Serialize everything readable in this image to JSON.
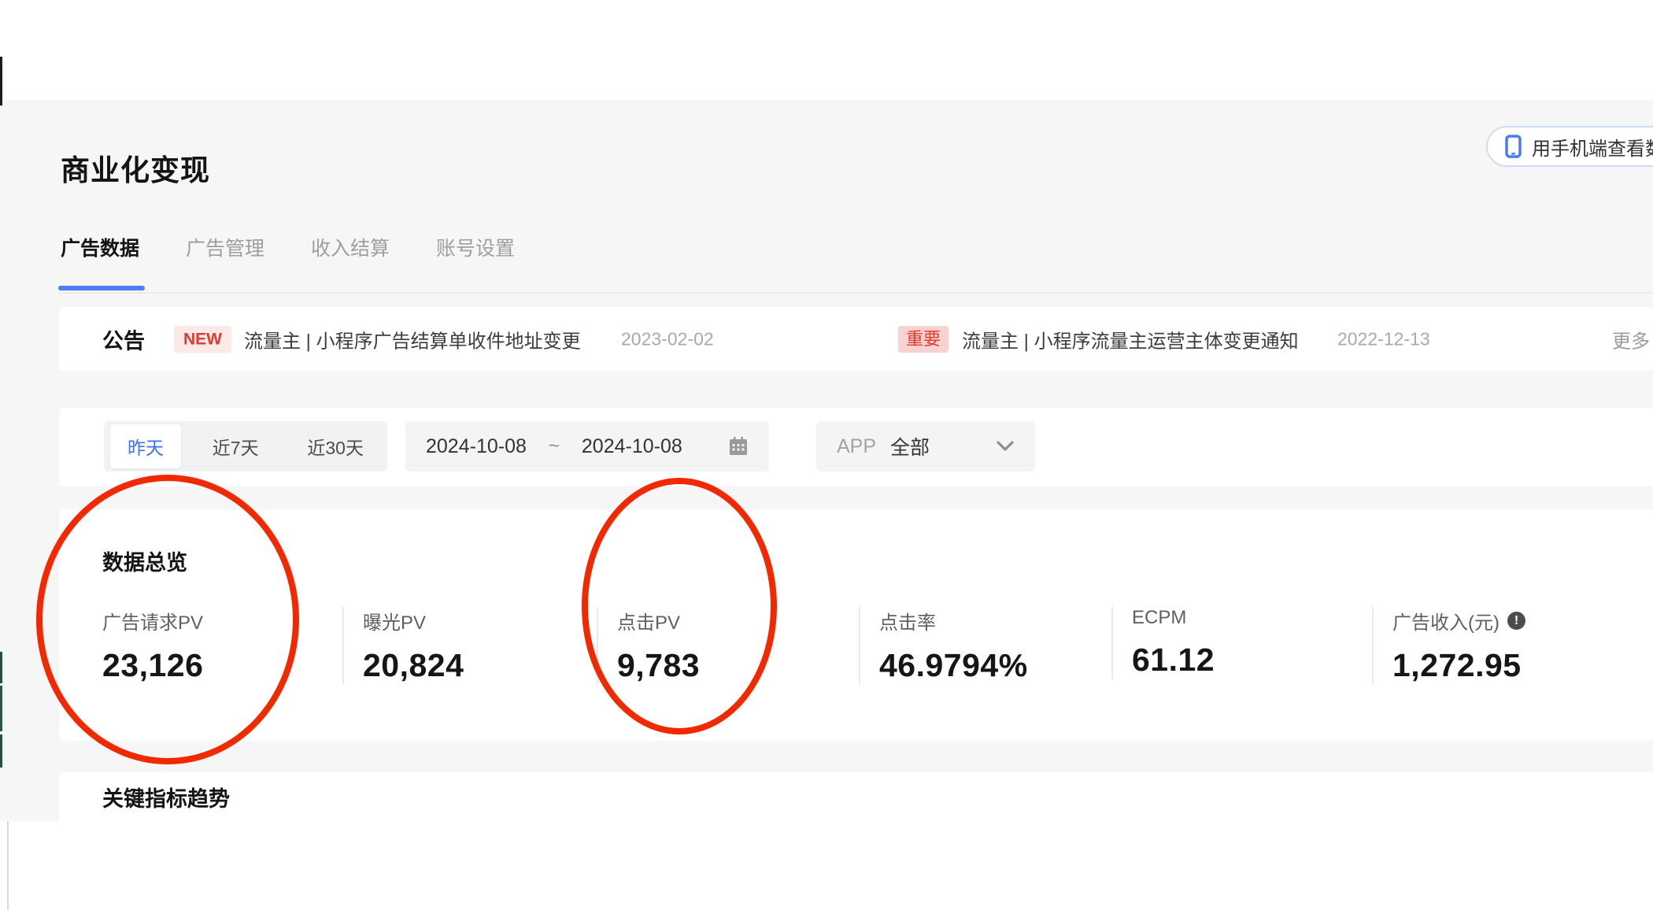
{
  "page": {
    "title": "商业化变现",
    "mobile_view_button": {
      "label": "用手机端查看数据"
    }
  },
  "tabs": {
    "items": [
      {
        "label": "广告数据",
        "active": true
      },
      {
        "label": "广告管理",
        "active": false
      },
      {
        "label": "收入结算",
        "active": false
      },
      {
        "label": "账号设置",
        "active": false
      }
    ]
  },
  "announcement": {
    "title": "公告",
    "items": [
      {
        "badge": "NEW",
        "text": "流量主 | 小程序广告结算单收件地址变更",
        "date": "2023-02-02"
      },
      {
        "badge": "重要",
        "text": "流量主 | 小程序流量主运营主体变更通知",
        "date": "2022-12-13"
      }
    ],
    "more_label": "更多"
  },
  "filters": {
    "quick_ranges": [
      {
        "label": "昨天",
        "active": true
      },
      {
        "label": "近7天",
        "active": false
      },
      {
        "label": "近30天",
        "active": false
      }
    ],
    "date_range": {
      "start": "2024-10-08",
      "separator": "~",
      "end": "2024-10-08"
    },
    "app_filter": {
      "label": "APP",
      "value": "全部"
    }
  },
  "overview": {
    "title": "数据总览",
    "metrics": [
      {
        "label": "广告请求PV",
        "value": "23,126"
      },
      {
        "label": "曝光PV",
        "value": "20,824"
      },
      {
        "label": "点击PV",
        "value": "9,783"
      },
      {
        "label": "点击率",
        "value": "46.9794%"
      },
      {
        "label": "ECPM",
        "value": "61.12"
      },
      {
        "label": "广告收入(元)",
        "value": "1,272.95",
        "has_info_icon": true
      }
    ]
  },
  "trend": {
    "title": "关键指标趋势"
  },
  "annotations": {
    "circle_color": "#f22800",
    "circled_metrics": [
      "广告请求PV",
      "点击PV"
    ]
  },
  "colors": {
    "accent_blue": "#4c7df2",
    "badge_red": "#e03a2f",
    "annotation_red": "#f22800",
    "panel_gray": "#f6f6f7"
  }
}
